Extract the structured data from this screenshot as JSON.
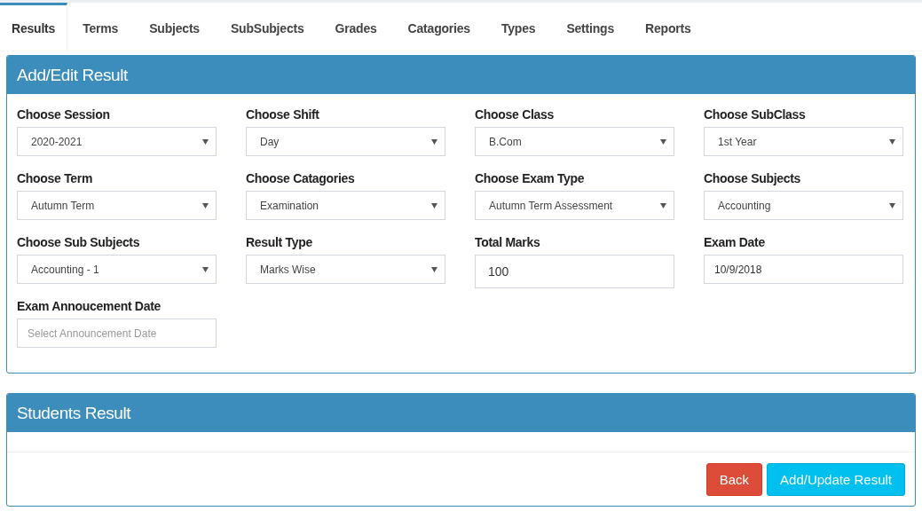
{
  "tabs": [
    {
      "label": "Results",
      "selected": true
    },
    {
      "label": "Terms",
      "selected": false
    },
    {
      "label": "Subjects",
      "selected": false
    },
    {
      "label": "SubSubjects",
      "selected": false
    },
    {
      "label": "Grades",
      "selected": false
    },
    {
      "label": "Catagories",
      "selected": false
    },
    {
      "label": "Types",
      "selected": false
    },
    {
      "label": "Settings",
      "selected": false
    },
    {
      "label": "Reports",
      "selected": false
    }
  ],
  "edit_panel": {
    "title": "Add/Edit Result",
    "fields": [
      {
        "label": "Choose Session",
        "kind": "select",
        "value": "2020-2021"
      },
      {
        "label": "Choose Shift",
        "kind": "select",
        "value": "Day"
      },
      {
        "label": "Choose Class",
        "kind": "select",
        "value": "B.Com"
      },
      {
        "label": "Choose SubClass",
        "kind": "select",
        "value": "1st Year"
      },
      {
        "label": "Choose Term",
        "kind": "select",
        "value": "Autumn Term"
      },
      {
        "label": "Choose Catagories",
        "kind": "select",
        "value": "Examination"
      },
      {
        "label": "Choose Exam Type",
        "kind": "select",
        "value": "Autumn Term Assessment"
      },
      {
        "label": "Choose Subjects",
        "kind": "select",
        "value": "Accounting"
      },
      {
        "label": "Choose Sub Subjects",
        "kind": "select",
        "value": "Accounting - 1"
      },
      {
        "label": "Result Type",
        "kind": "select",
        "value": "Marks Wise"
      },
      {
        "label": "Total Marks",
        "kind": "number",
        "value": "100"
      },
      {
        "label": "Exam Date",
        "kind": "date",
        "value": "10/9/2018"
      },
      {
        "label": "Exam Annoucement Date",
        "kind": "date",
        "placeholder": "Select Announcement Date"
      }
    ]
  },
  "students_panel": {
    "title": "Students Result",
    "buttons": [
      {
        "label": "Back",
        "kind": "danger"
      },
      {
        "label": "Add/Update Result",
        "kind": "primary"
      }
    ]
  }
}
